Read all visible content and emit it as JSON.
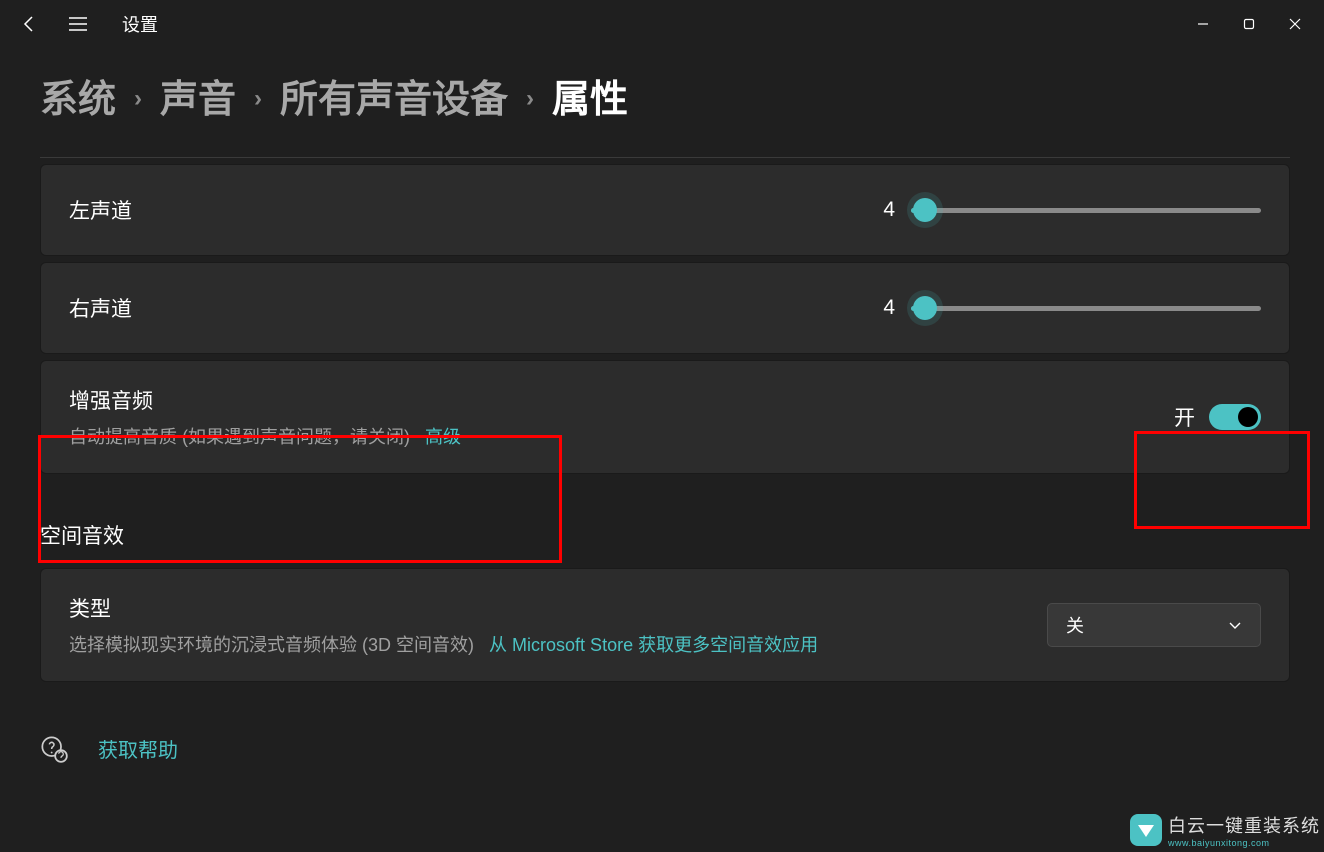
{
  "titlebar": {
    "title": "设置"
  },
  "breadcrumb": {
    "items": [
      "系统",
      "声音",
      "所有声音设备",
      "属性"
    ]
  },
  "channels": {
    "left": {
      "label": "左声道",
      "value": "4"
    },
    "right": {
      "label": "右声道",
      "value": "4"
    }
  },
  "enhance": {
    "title": "增强音频",
    "subtitle": "自动提高音质 (如果遇到声音问题，请关闭)",
    "advanced": "高级",
    "state": "开"
  },
  "spatial": {
    "heading": "空间音效",
    "type_label": "类型",
    "type_subtitle": "选择模拟现实环境的沉浸式音频体验 (3D 空间音效)",
    "store_link": "从 Microsoft Store 获取更多空间音效应用",
    "selected": "关"
  },
  "help": {
    "label": "获取帮助"
  },
  "watermark": {
    "line1": "白云一键重装系统",
    "line2": "www.baiyunxitong.com"
  }
}
